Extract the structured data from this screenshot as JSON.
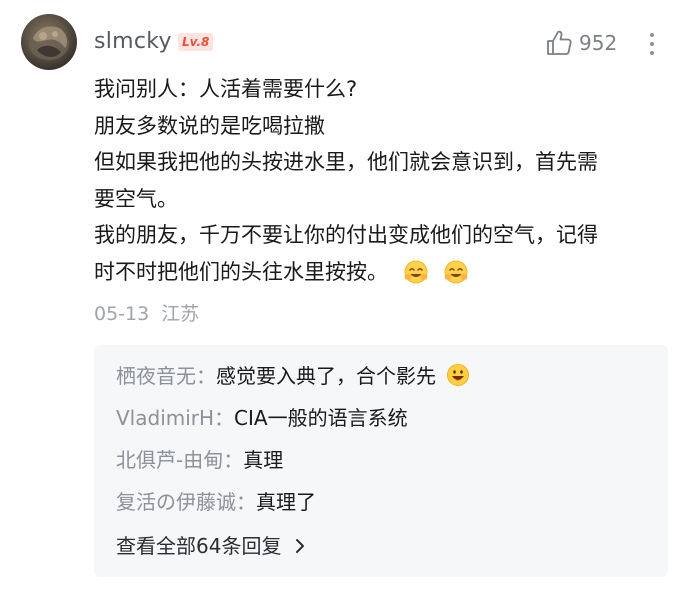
{
  "comment": {
    "username": "slmcky",
    "level": "Lv.8",
    "like_count": "952",
    "lines": [
      "我问别人：人活着需要什么?",
      "朋友多数说的是吃喝拉撒",
      "但如果我把他的头按进水里，他们就会意识到，首先需",
      "要空气。",
      "我的朋友，千万不要让你的付出变成他们的空气，记得",
      "时不时把他们的头往水里按按。"
    ],
    "date": "05-13",
    "location": "江苏",
    "icons": [
      "avatar",
      "like-icon",
      "more-icon",
      "smile-emoji-icon"
    ]
  },
  "replies": [
    {
      "author": "栖夜音无",
      "separator": "：",
      "text": "感觉要入典了，合个影先"
    },
    {
      "author": "VladimirH",
      "separator": "：",
      "text": "CIA一般的语言系统"
    },
    {
      "author": "北俱芦-由甸",
      "separator": "：",
      "text": "真理"
    },
    {
      "author": "复活の伊藤诚",
      "separator": "：",
      "text": "真理了"
    }
  ],
  "view_all_replies": "查看全部64条回复",
  "colors": {
    "username": "#555a60",
    "level_badge_bg": "#fde4df",
    "level_badge_text": "#e8513b",
    "meta": "#a0a4aa",
    "reply_author": "#8d9198",
    "reply_bg": "#f6f7f9"
  }
}
